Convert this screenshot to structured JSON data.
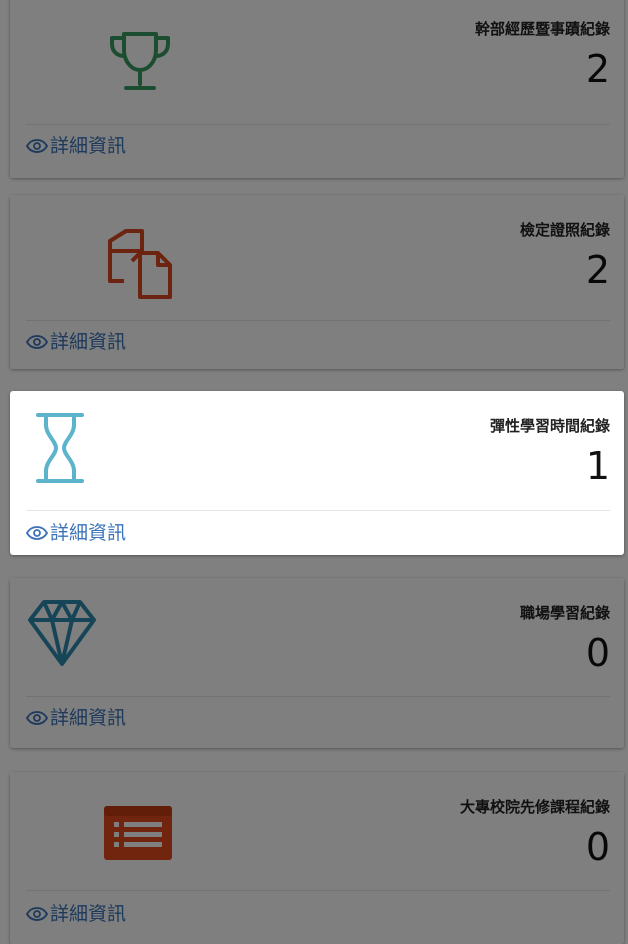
{
  "cards": [
    {
      "title": "幹部經歷暨事蹟紀錄",
      "count": "2",
      "link": "詳細資訊",
      "icon": "trophy-icon",
      "icon_color": "#3a9a62",
      "active": false
    },
    {
      "title": "檢定證照紀錄",
      "count": "2",
      "link": "詳細資訊",
      "icon": "copy-documents-icon",
      "icon_color": "#d9461e",
      "active": false
    },
    {
      "title": "彈性學習時間紀錄",
      "count": "1",
      "link": "詳細資訊",
      "icon": "hourglass-icon",
      "icon_color": "#5cb3cc",
      "active": true
    },
    {
      "title": "職場學習紀錄",
      "count": "0",
      "link": "詳細資訊",
      "icon": "diamond-icon",
      "icon_color": "#2f8bb1",
      "active": false
    },
    {
      "title": "大專校院先修課程紀錄",
      "count": "0",
      "link": "詳細資訊",
      "icon": "list-panel-icon",
      "icon_color": "#e24a1f",
      "active": false
    }
  ],
  "colors": {
    "link": "#3b73b9",
    "overlay_background": "#808080",
    "card_background": "#ffffff"
  }
}
